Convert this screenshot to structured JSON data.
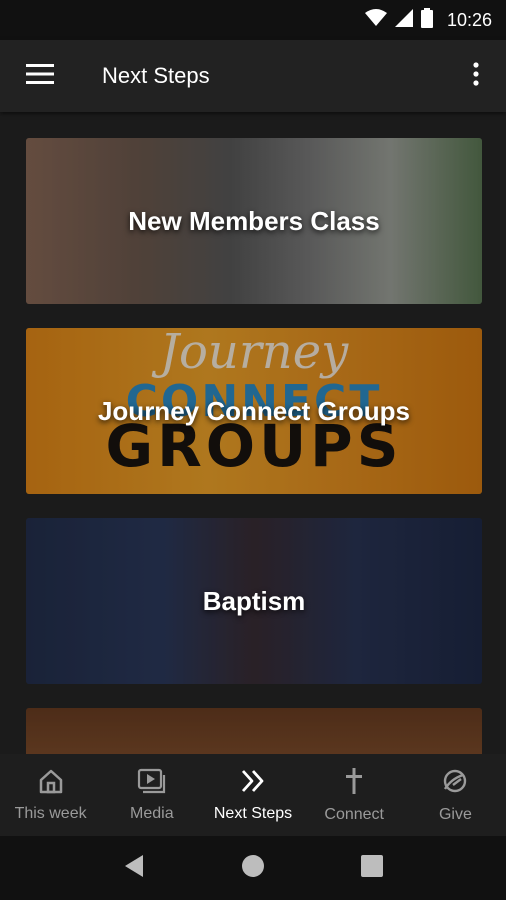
{
  "status_bar": {
    "time": "10:26",
    "icons": [
      "wifi-icon",
      "signal-icon",
      "battery-icon"
    ]
  },
  "app_bar": {
    "title": "Next Steps",
    "menu_icon": "hamburger-menu-icon",
    "more_icon": "more-vertical-icon"
  },
  "cards": [
    {
      "label": "New Members Class"
    },
    {
      "label": "Journey Connect Groups",
      "artwork": {
        "script": "Journey",
        "line1": "CONNECT",
        "line2": "GROUPS"
      }
    },
    {
      "label": "Baptism"
    },
    {
      "label": ""
    }
  ],
  "bottom_nav": {
    "items": [
      {
        "label": "This week",
        "icon": "home-icon",
        "active": false
      },
      {
        "label": "Media",
        "icon": "media-play-icon",
        "active": false
      },
      {
        "label": "Next Steps",
        "icon": "double-chevron-icon",
        "active": true
      },
      {
        "label": "Connect",
        "icon": "cross-icon",
        "active": false
      },
      {
        "label": "Give",
        "icon": "give-icon",
        "active": false
      }
    ]
  },
  "colors": {
    "background": "#1b1b1b",
    "app_bar": "#222222",
    "active_nav": "#ffffff",
    "inactive_nav": "#9a9a9a"
  }
}
